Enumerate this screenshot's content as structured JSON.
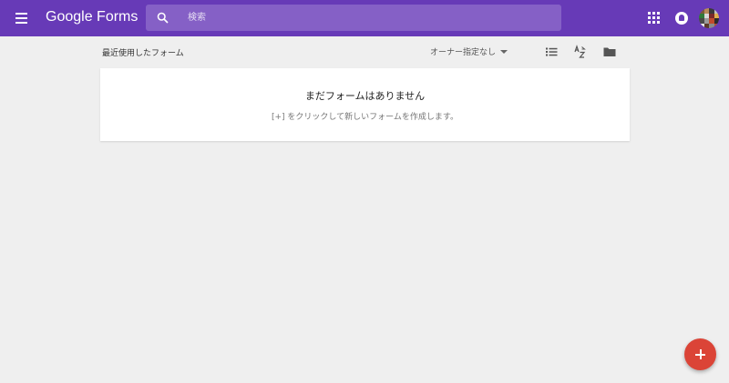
{
  "header": {
    "brand": "Google Forms",
    "menu_icon": "hamburger-menu-icon",
    "search": {
      "placeholder": "検索",
      "value": "",
      "icon": "search-icon"
    },
    "apps_icon": "apps-grid-icon",
    "notifications_icon": "notifications-icon",
    "avatar": "avatar",
    "bar_color": "#673ab7"
  },
  "toolbar": {
    "section_title": "最近使用したフォーム",
    "owner_filter": "オーナー指定なし",
    "owner_filter_icon": "caret-down-icon",
    "icons": [
      "list-view-icon",
      "sort-az-icon",
      "folder-icon"
    ]
  },
  "empty_state": {
    "title": "まだフォームはありません",
    "subtitle": "[+] をクリックして新しいフォームを作成します。"
  },
  "fab": {
    "icon": "plus-icon",
    "color": "#db4437"
  }
}
